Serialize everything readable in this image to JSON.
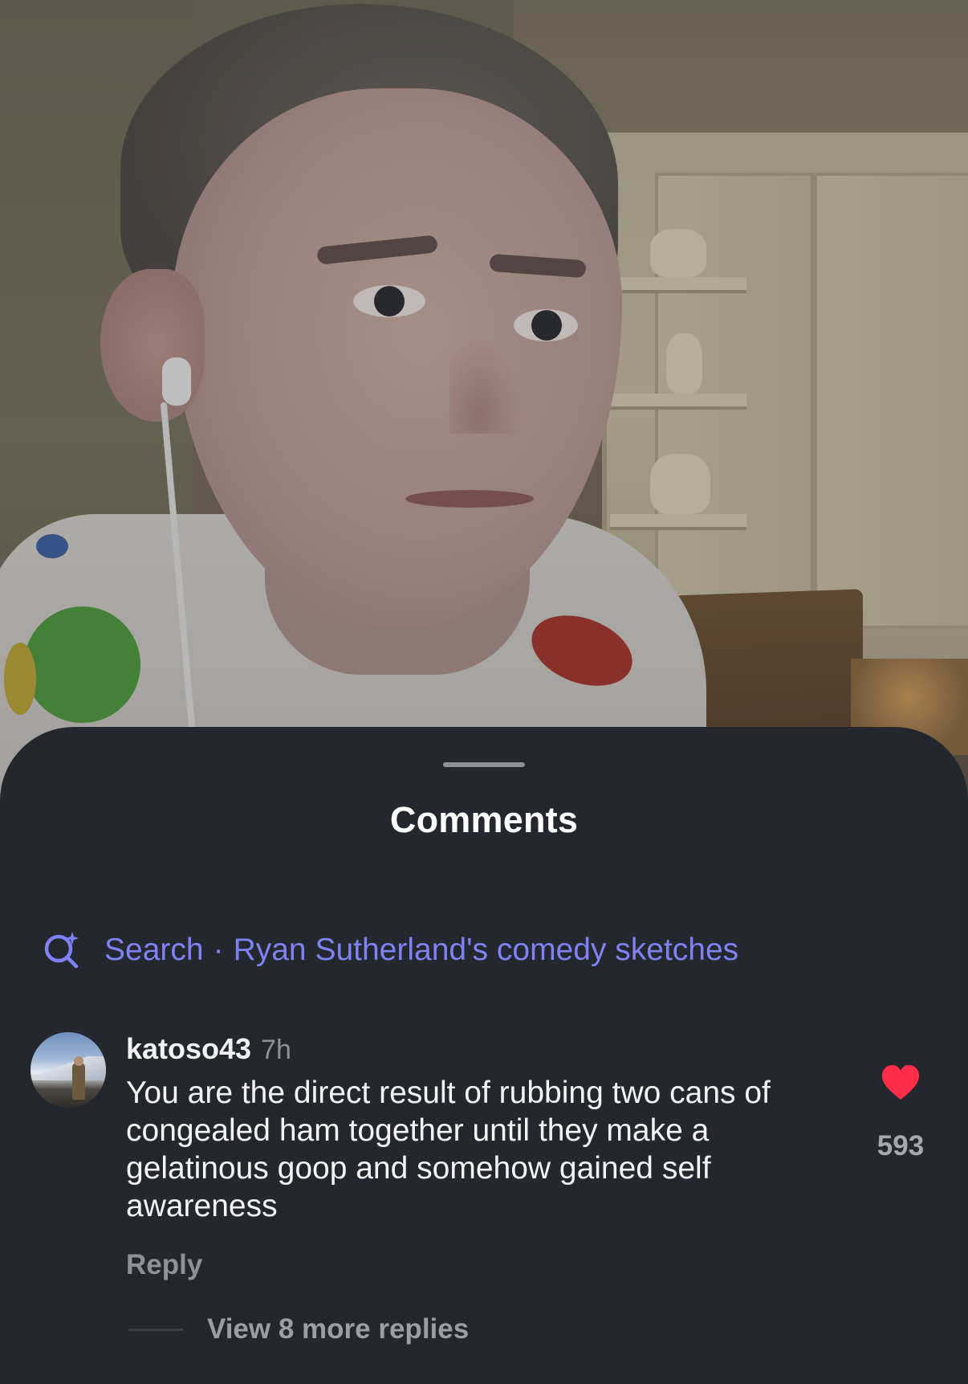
{
  "sheet": {
    "title": "Comments",
    "search": {
      "prefix": "Search",
      "separator": "·",
      "query": "Ryan Sutherland's comedy sketches",
      "icon": "sparkle-search-icon",
      "color": "#7f82f2"
    }
  },
  "comment": {
    "username": "katoso43",
    "timestamp": "7h",
    "text": "You are the direct result of rubbing two cans of congealed ham together until they make a gelatinous goop and somehow gained self awareness",
    "reply_label": "Reply",
    "like_icon": "heart-icon",
    "like_color": "#ff2d47",
    "like_count": "593",
    "view_replies_label": "View 8 more replies"
  },
  "colors": {
    "sheet_background": "#24272d",
    "primary_text": "#f4f4f6",
    "secondary_text": "#8e9198"
  }
}
